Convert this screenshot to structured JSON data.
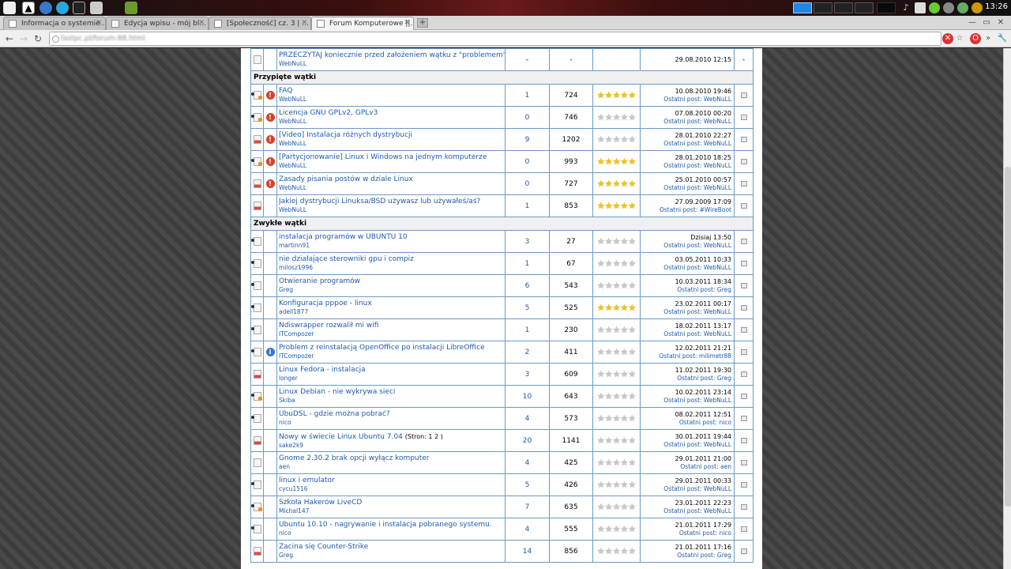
{
  "os_panel": {
    "clock": "13:26",
    "launchers": [
      "penguin-icon",
      "browser-icon",
      "chrome-icon",
      "terminal-icon",
      "diamond-icon",
      "game-icon"
    ],
    "tray": [
      "volume-icon",
      "network-icon",
      "battery-icon",
      "monitor-icon",
      "user-icon"
    ]
  },
  "browser": {
    "tabs": [
      {
        "label": "Informacja o systemie..."
      },
      {
        "label": "Edycja wpisu - mój bl..."
      },
      {
        "label": "[Społeczność] cz. 3 | ..."
      },
      {
        "label": "Forum Komputerowe ||..."
      }
    ],
    "url": "fastpc.pl/forum-88.html"
  },
  "forum": {
    "sections": {
      "pinned": "Przypięte wątki",
      "normal": "Zwykłe wątki"
    },
    "announcement": {
      "title": "PRZECZYTAJ koniecznie przed założeniem wątku z \"problemem\"",
      "author": "WebNuLL",
      "replies": "-",
      "views": "-",
      "last_date": "29.08.2010 12:15",
      "last_by": "",
      "mod": "-"
    },
    "last_post_prefix": "Ostatni post:",
    "pinned": [
      {
        "icon": "dot-hot",
        "emo": "warn",
        "title": "FAQ",
        "author": "WebNuLL",
        "replies": "1",
        "views": "724",
        "rating": 5,
        "last_date": "10.08.2010 19:46",
        "last_by": "WebNuLL"
      },
      {
        "icon": "dot-hot",
        "emo": "warn",
        "title": "Licencja GNU GPLv2, GPLv3",
        "author": "WebNuLL",
        "replies": "0",
        "views": "746",
        "rating": 0,
        "last_date": "07.08.2010 00:20",
        "last_by": "WebNuLL"
      },
      {
        "icon": "hot",
        "emo": "warn",
        "title": "[Video] Instalacja różnych dystrybucji",
        "author": "WebNuLL",
        "replies": "9",
        "views": "1202",
        "rating": 0,
        "last_date": "28.01.2010 22:27",
        "last_by": "WebNuLL"
      },
      {
        "icon": "dot-hot",
        "emo": "warn",
        "title": "[Partycjonowanie] Linux i Windows na jednym komputerze",
        "author": "WebNuLL",
        "replies": "0",
        "views": "993",
        "rating": 5,
        "last_date": "28.01.2010 18:25",
        "last_by": "WebNuLL"
      },
      {
        "icon": "hot",
        "emo": "warn",
        "title": "Zasady pisania postów w dziale Linux",
        "author": "WebNuLL",
        "replies": "0",
        "views": "727",
        "rating": 5,
        "last_date": "25.01.2010 00:57",
        "last_by": "WebNuLL"
      },
      {
        "icon": "hot",
        "emo": "",
        "title": "Jakiej dystrybucji Linuksa/BSD używasz lub używałeś/aś?",
        "author": "WebNuLL",
        "replies": "1",
        "views": "853",
        "rating": 5,
        "last_date": "27.09.2009 17:09",
        "last_by": "#WireBoot"
      }
    ],
    "normal": [
      {
        "icon": "dot",
        "emo": "",
        "title": "instalacja programów w UBUNTU 10",
        "pages": "",
        "author": "martinn91",
        "replies": "3",
        "views": "27",
        "rating": 0,
        "last_date": "Dzisiaj 13:50",
        "last_by": "WebNuLL"
      },
      {
        "icon": "dot",
        "emo": "",
        "title": "nie działające sterowniki gpu i compiz",
        "pages": "",
        "author": "milosz1996",
        "replies": "1",
        "views": "67",
        "rating": 0,
        "last_date": "03.05.2011 10:33",
        "last_by": "WebNuLL"
      },
      {
        "icon": "dot",
        "emo": "",
        "title": "Otwieranie programów",
        "pages": "",
        "author": "Greg",
        "replies": "6",
        "views": "543",
        "rating": 0,
        "last_date": "10.03.2011 18:34",
        "last_by": "Greg"
      },
      {
        "icon": "dot",
        "emo": "",
        "title": "Konfiguracja pppoe - linux",
        "pages": "",
        "author": "adell1877",
        "replies": "5",
        "views": "525",
        "rating": 5,
        "last_date": "23.02.2011 00:17",
        "last_by": "WebNuLL"
      },
      {
        "icon": "dot",
        "emo": "",
        "title": "Ndiswrapper rozwalił mi wifi",
        "pages": "",
        "author": "ITCompozer",
        "replies": "1",
        "views": "230",
        "rating": 0,
        "last_date": "18.02.2011 13:17",
        "last_by": "WebNuLL"
      },
      {
        "icon": "dot",
        "emo": "info",
        "title": "Problem z reinstalacją OpenOffice po instalacji LibreOffice",
        "pages": "",
        "author": "ITCompozer",
        "replies": "2",
        "views": "411",
        "rating": 0,
        "last_date": "12.02.2011 21:21",
        "last_by": "milimetr88"
      },
      {
        "icon": "hot",
        "emo": "",
        "title": "Linux Fedora - instalacja",
        "pages": "",
        "author": "longer",
        "replies": "3",
        "views": "609",
        "rating": 0,
        "last_date": "11.02.2011 19:30",
        "last_by": "Greg"
      },
      {
        "icon": "dot-hot",
        "emo": "",
        "title": "Linux Debian - nie wykrywa sieci",
        "pages": "",
        "author": "Skiba",
        "replies": "10",
        "views": "643",
        "rating": 0,
        "last_date": "10.02.2011 23:14",
        "last_by": "WebNuLL"
      },
      {
        "icon": "dot",
        "emo": "",
        "title": "UbuDSL - gdzie można pobrać?",
        "pages": "",
        "author": "nico",
        "replies": "4",
        "views": "573",
        "rating": 0,
        "last_date": "08.02.2011 12:51",
        "last_by": "nico"
      },
      {
        "icon": "hot",
        "emo": "",
        "title": "Nowy w świecie Linux Ubuntu 7.04",
        "pages": "(Stron: 1 2 )",
        "author": "sake2k9",
        "replies": "20",
        "views": "1141",
        "rating": 0,
        "last_date": "30.01.2011 19:44",
        "last_by": "WebNuLL"
      },
      {
        "icon": "plain",
        "emo": "",
        "title": "Gnome 2.30.2 brak opcji wyłącz komputer",
        "pages": "",
        "author": "aen",
        "replies": "4",
        "views": "425",
        "rating": 0,
        "last_date": "29.01.2011 21:00",
        "last_by": "aen"
      },
      {
        "icon": "dot",
        "emo": "",
        "title": "linux i emulator",
        "pages": "",
        "author": "cycu1516",
        "replies": "5",
        "views": "426",
        "rating": 0,
        "last_date": "29.01.2011 00:33",
        "last_by": "WebNuLL"
      },
      {
        "icon": "dot-hot",
        "emo": "",
        "title": "Szkoła Hakerów LiveCD",
        "pages": "",
        "author": "Michal147",
        "replies": "7",
        "views": "635",
        "rating": 0,
        "last_date": "23.01.2011 22:23",
        "last_by": "WebNuLL"
      },
      {
        "icon": "dot",
        "emo": "",
        "title": "Ubuntu 10.10 - nagrywanie i instalacja pobranego systemu.",
        "pages": "",
        "author": "nico",
        "replies": "4",
        "views": "555",
        "rating": 0,
        "last_date": "21.01.2011 17:29",
        "last_by": "nico"
      },
      {
        "icon": "hot",
        "emo": "",
        "title": "Zacina się Counter-Strike",
        "pages": "",
        "author": "Greg",
        "replies": "14",
        "views": "856",
        "rating": 0,
        "last_date": "21.01.2011 17:16",
        "last_by": "Greg"
      }
    ]
  }
}
